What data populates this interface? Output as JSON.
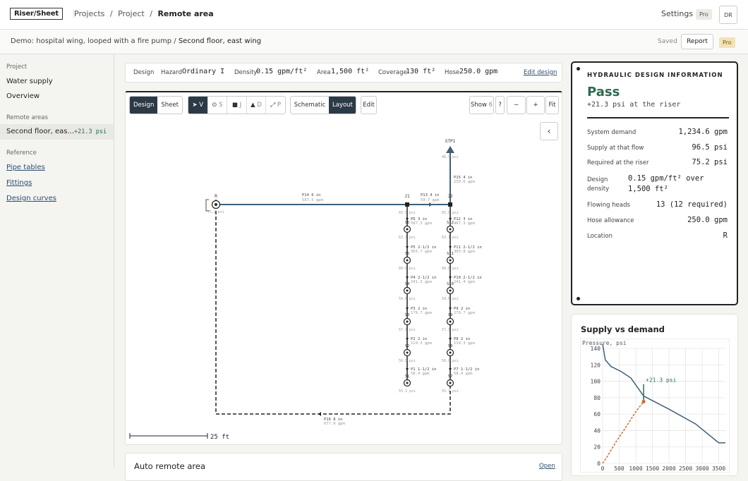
{
  "topbar": {
    "logo": "Riser/Sheet",
    "breadcrumbs": [
      "Projects",
      "/",
      "Project",
      "/",
      "Remote area"
    ],
    "settings": "Settings",
    "pro": "Pro",
    "avatar": "DR"
  },
  "subbar": {
    "demo_prefix": "Demo: hospital wing, looped with a fire pump / ",
    "demo_area": "Second floor, east wing",
    "saved": "Saved",
    "report": "Report",
    "pro": "Pro"
  },
  "sidebar": {
    "project_heading": "Project",
    "project_items": [
      "Water supply",
      "Overview"
    ],
    "remote_heading": "Remote areas",
    "remote_item": {
      "name": "Second floor, eas...",
      "value": "+21.3 psi"
    },
    "reference_heading": "Reference",
    "reference_items": [
      "Pipe tables",
      "Fittings",
      "Design curves"
    ]
  },
  "designbar": {
    "design": "Design",
    "hazard_label": "Hazard",
    "hazard": "Ordinary I",
    "density_label": "Density",
    "density": "0.15 gpm/ft²",
    "area_label": "Area",
    "area": "1,500 ft²",
    "coverage_label": "Coverage",
    "coverage": "130 ft²",
    "hose_label": "Hose",
    "hose": "250.0 gpm",
    "edit": "Edit design"
  },
  "toolbar": {
    "tabs": [
      "Design",
      "Sheet"
    ],
    "tools": [
      {
        "icon": "pointer-icon",
        "key": "V"
      },
      {
        "icon": "sprinkler-icon",
        "key": "S"
      },
      {
        "icon": "junction-icon",
        "key": "J"
      },
      {
        "icon": "source-icon",
        "key": "D"
      },
      {
        "icon": "pipe-icon",
        "key": "P"
      }
    ],
    "views": [
      "Schematic",
      "Layout"
    ],
    "edit": "Edit",
    "show": "Show",
    "show_count": "6",
    "help": "?",
    "zoom_out": "−",
    "zoom_in": "+",
    "fit": "Fit",
    "collapse": "‹"
  },
  "diagram": {
    "scale_label": "25 ft",
    "source": {
      "name": "STP1",
      "pressure": "46.9 psi"
    },
    "riser": {
      "name": "R",
      "pressure": "75.2 psi"
    },
    "junctions": [
      {
        "name": "J1",
        "pressure": "65.0 psi"
      },
      {
        "name": "J2",
        "pressure": "65.0 psi"
      }
    ],
    "pipes": [
      {
        "id": "P15",
        "size": "4 in",
        "flow": "250.0 gpm"
      },
      {
        "id": "P14",
        "size": "6 in",
        "flow": "597.5 gpm"
      },
      {
        "id": "P13",
        "size": "4 in",
        "flow": "59.7 gpm"
      },
      {
        "id": "P6",
        "size": "3 in",
        "flow": "567.3 gpm"
      },
      {
        "id": "P12",
        "size": "3 in",
        "flow": "467.3 gpm"
      },
      {
        "id": "P5",
        "size": "2-1/2 in",
        "flow": "303.7 gpm"
      },
      {
        "id": "P11",
        "size": "2-1/2 in",
        "flow": "303.8 gpm"
      },
      {
        "id": "P4",
        "size": "2-1/2 in",
        "flow": "241.3 gpm"
      },
      {
        "id": "P10",
        "size": "2-1/2 in",
        "flow": "241.4 gpm"
      },
      {
        "id": "P3",
        "size": "2 in",
        "flow": "179.7 gpm"
      },
      {
        "id": "P9",
        "size": "2 in",
        "flow": "179.7 gpm"
      },
      {
        "id": "P2",
        "size": "2 in",
        "flow": "119.3 gpm"
      },
      {
        "id": "P8",
        "size": "2 in",
        "flow": "119.3 gpm"
      },
      {
        "id": "P1",
        "size": "1-1/2 in",
        "flow": "58.4 gpm"
      },
      {
        "id": "P7",
        "size": "1-1/2 in",
        "flow": "58.4 gpm"
      },
      {
        "id": "P16",
        "size": "8 in",
        "flow": "677.0 gpm"
      }
    ],
    "heads_left": [
      {
        "name": "S6",
        "pressure": "63.1 psi"
      },
      {
        "name": "S5",
        "pressure": "60.8 psi"
      },
      {
        "name": "S4",
        "pressure": "59.6 psi"
      },
      {
        "name": "S3",
        "pressure": "57.1 psi"
      },
      {
        "name": "S2",
        "pressure": "56.0 psi"
      },
      {
        "name": "S1",
        "pressure": "55.1 psi"
      }
    ],
    "heads_right": [
      {
        "name": "S12",
        "pressure": "63.1 psi"
      },
      {
        "name": "S11",
        "pressure": "60.8 psi"
      },
      {
        "name": "S10",
        "pressure": "59.6 psi"
      },
      {
        "name": "S9",
        "pressure": "57.1 psi"
      },
      {
        "name": "S8",
        "pressure": "56.0 psi"
      },
      {
        "name": "S7",
        "pressure": "55.1 psi"
      }
    ]
  },
  "autoarea": {
    "title": "Auto remote area",
    "open": "Open"
  },
  "hydraulic": {
    "title": "HYDRAULIC DESIGN INFORMATION",
    "status": "Pass",
    "status_detail": "+21.3 psi at the riser",
    "rows": [
      {
        "label": "System demand",
        "value": "1,234.6 gpm"
      },
      {
        "label": "Supply at that flow",
        "value": "96.5 psi"
      },
      {
        "label": "Required at the riser",
        "value": "75.2 psi"
      },
      {
        "label": "Design density",
        "value": "0.15 gpm/ft² over 1,500 ft²"
      },
      {
        "label": "Flowing heads",
        "value": "13 (12 required)"
      },
      {
        "label": "Hose allowance",
        "value": "250.0 gpm"
      },
      {
        "label": "Location",
        "value": "R"
      }
    ],
    "pass_color": "#2d6b4f"
  },
  "chart_data": {
    "type": "line",
    "title": "Supply vs demand",
    "ylabel": "Pressure, psi",
    "xlabel": "",
    "xlim": [
      0,
      3700
    ],
    "ylim": [
      0,
      140
    ],
    "x_ticks": [
      "0",
      "500",
      "1000",
      "1500",
      "2000",
      "2500",
      "3000",
      "3500"
    ],
    "y_ticks": [
      "0",
      "20",
      "40",
      "60",
      "80",
      "100",
      "120",
      "140"
    ],
    "grid": true,
    "series": [
      {
        "style": "solid",
        "color": "#3f5f78",
        "x": [
          0,
          80,
          250,
          550,
          850,
          1234.6,
          2000,
          2800,
          3500,
          3700
        ],
        "y": [
          145,
          126,
          118,
          112,
          104,
          82,
          66,
          48,
          25,
          25
        ]
      },
      {
        "style": "dashed",
        "color": "#d16a2a",
        "x": [
          0,
          150,
          400,
          700,
          1000,
          1234.6
        ],
        "y": [
          0,
          9,
          26,
          44,
          63,
          75.2
        ]
      }
    ],
    "annotation": {
      "text": "+21.3 psi",
      "x": 1234.6,
      "y_from": 75.2,
      "y_to": 96.5,
      "color": "#2d6b4f"
    }
  }
}
